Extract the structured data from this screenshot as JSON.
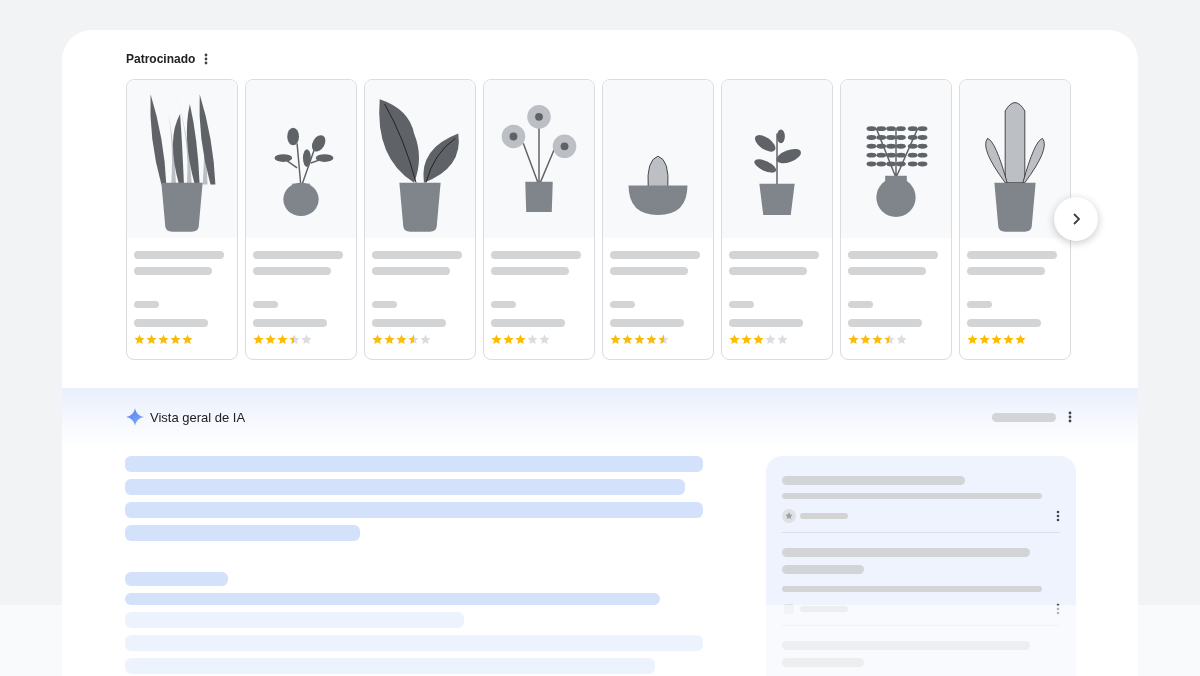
{
  "sponsored": {
    "title": "Patrocinado",
    "products": [
      {
        "stars": 5
      },
      {
        "stars": 3.5
      },
      {
        "stars": 3.5
      },
      {
        "stars": 3
      },
      {
        "stars": 4.5
      },
      {
        "stars": 3
      },
      {
        "stars": 3.5
      },
      {
        "stars": 5
      }
    ]
  },
  "ai_overview": {
    "title": "Vista geral de IA"
  }
}
